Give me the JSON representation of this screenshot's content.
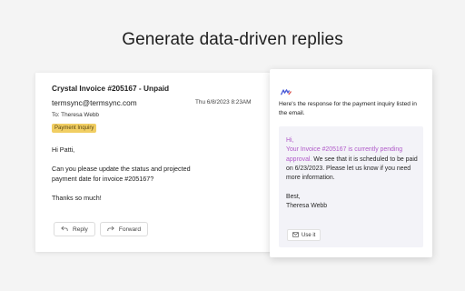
{
  "headline": "Generate data-driven replies",
  "email": {
    "subject": "Crystal Invoice #205167 - Unpaid",
    "from": "termsync@termsync.com",
    "date": "Thu 6/8/2023 8:23AM",
    "to": "To: Theresa Webb",
    "badge": "Payment Inquiry",
    "greeting": "Hi Patti,",
    "body": "Can you please update the status and projected payment date for invoice #205167?",
    "signoff": "Thanks so much!",
    "reply_label": "Reply",
    "forward_label": "Forward"
  },
  "response": {
    "intro": "Here's the response for the payment inquiry listed in the email.",
    "greeting": "Hi,",
    "highlight": "Your Invoice #205167 is currently pending approval.",
    "body_rest": " We see that it is scheduled to be paid on 6/23/2023. Please let us know if you need more information.",
    "closing": "Best,",
    "signature": "Theresa Webb",
    "use_label": "Use it"
  },
  "colors": {
    "badge_bg": "#f1ce63",
    "highlight": "#b05ac9",
    "logo": "#4a5ad6"
  },
  "icons": {
    "logo": "app-logo-icon",
    "reply": "reply-arrow-icon",
    "forward": "forward-arrow-icon",
    "use": "mail-icon"
  }
}
